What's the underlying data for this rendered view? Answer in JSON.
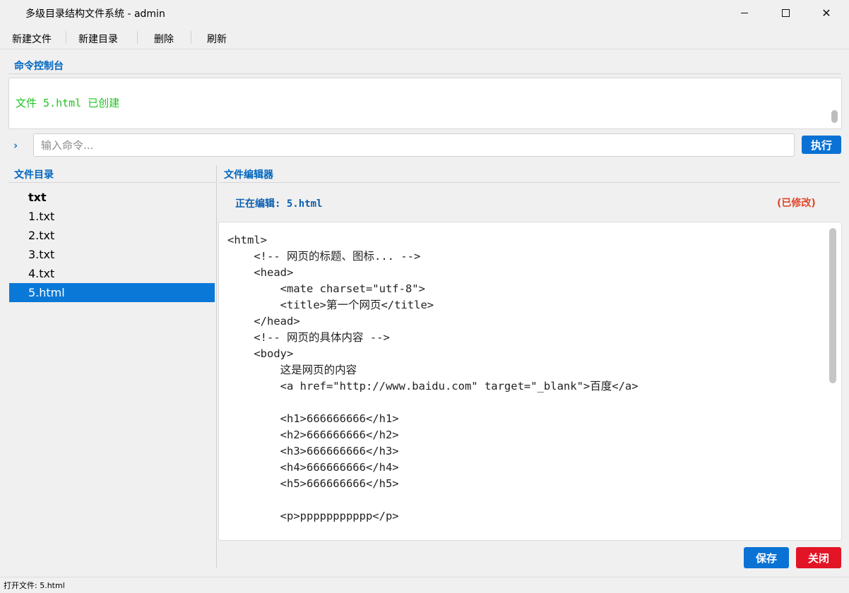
{
  "window": {
    "title": "多级目录结构文件系统 - admin",
    "controls": {
      "minimize": "minimize-icon",
      "maximize": "maximize-icon",
      "close": "✕"
    }
  },
  "menu": {
    "new_file": "新建文件",
    "new_dir": "新建目录",
    "delete": "删除",
    "refresh": "刷新"
  },
  "console": {
    "label": "命令控制台",
    "lines": [
      "文件 5.html 已创建"
    ],
    "prompt_symbol": "›",
    "input_placeholder": "输入命令...",
    "input_value": "",
    "exec_label": "执行"
  },
  "file_tree": {
    "label": "文件目录",
    "items": [
      {
        "name": "txt",
        "type": "directory"
      },
      {
        "name": "1.txt",
        "type": "file"
      },
      {
        "name": "2.txt",
        "type": "file"
      },
      {
        "name": "3.txt",
        "type": "file"
      },
      {
        "name": "4.txt",
        "type": "file"
      },
      {
        "name": "5.html",
        "type": "file",
        "selected": true
      }
    ]
  },
  "editor": {
    "label": "文件编辑器",
    "status": "正在编辑: 5.html",
    "modified": "(已修改)",
    "content_lines": [
      "<html>",
      "    <!-- 网页的标题、图标... -->",
      "    <head>",
      "        <mate charset=\"utf-8\">",
      "        <title>第一个网页</title>",
      "    </head>",
      "    <!-- 网页的具体内容 -->",
      "    <body>",
      "        这是网页的内容",
      "        <a href=\"http://www.baidu.com\" target=\"_blank\">百度</a>",
      "",
      "        <h1>666666666</h1>",
      "        <h2>666666666</h2>",
      "        <h3>666666666</h3>",
      "        <h4>666666666</h4>",
      "        <h5>666666666</h5>",
      "",
      "        <p>ppppppppppp</p>"
    ],
    "save_label": "保存",
    "close_label": "关闭"
  },
  "statusbar": {
    "text": "打开文件: 5.html"
  },
  "colors": {
    "accent": "#0a72d4",
    "selection": "#0a78d7",
    "danger": "#e21425",
    "console_text": "#22c322",
    "modified": "#e0482a",
    "section_label": "#0066c0"
  }
}
